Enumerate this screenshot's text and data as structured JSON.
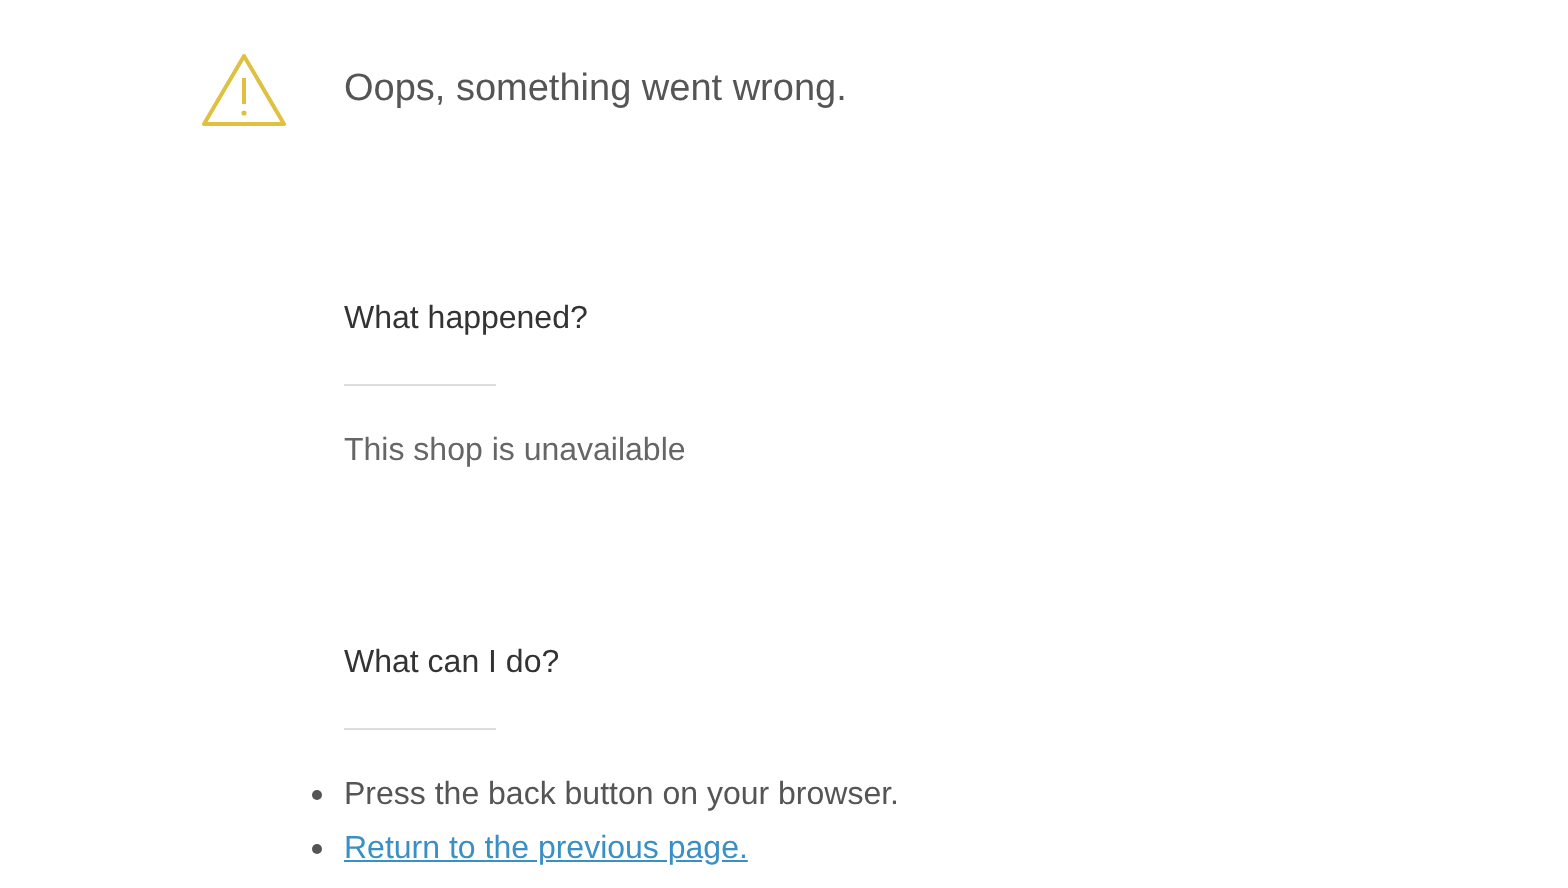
{
  "header": {
    "title": "Oops, something went wrong."
  },
  "sections": [
    {
      "heading": "What happened?",
      "kind": "text",
      "text": "This shop is unavailable"
    },
    {
      "heading": "What can I do?",
      "kind": "list",
      "items": [
        {
          "kind": "text",
          "text": "Press the back button on your browser."
        },
        {
          "kind": "link",
          "text": "Return to the previous page."
        }
      ]
    }
  ]
}
